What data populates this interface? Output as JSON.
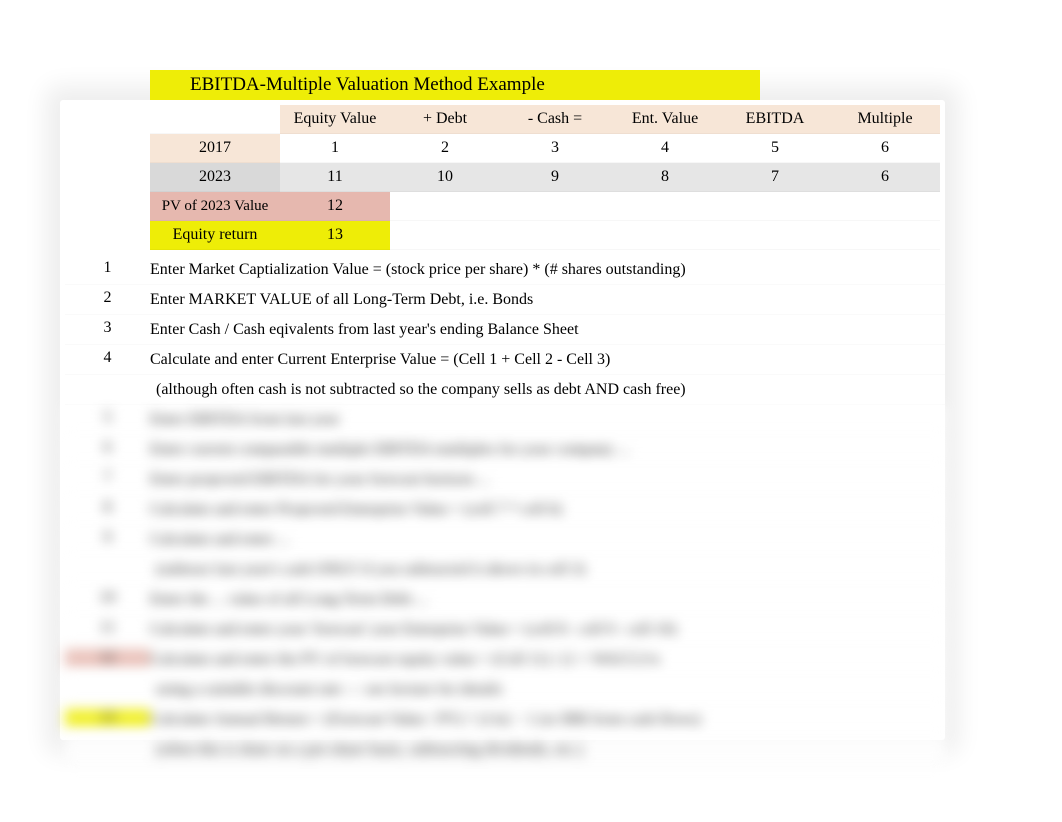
{
  "title": "EBITDA-Multiple Valuation Method Example",
  "headers": {
    "c1": "Equity Value",
    "c2": "+ Debt",
    "c3": "- Cash =",
    "c4": "Ent. Value",
    "c5": "EBITDA",
    "c6": "Multiple"
  },
  "rows": {
    "y2017": {
      "label": "2017",
      "c1": "1",
      "c2": "2",
      "c3": "3",
      "c4": "4",
      "c5": "5",
      "c6": "6"
    },
    "y2023": {
      "label": "2023",
      "c1": "11",
      "c2": "10",
      "c3": "9",
      "c4": "8",
      "c5": "7",
      "c6": "6"
    },
    "pv": {
      "label": "PV of 2023 Value",
      "c1": "12"
    },
    "eqret": {
      "label": "Equity return",
      "c1": "13"
    }
  },
  "instructions": [
    {
      "n": "1",
      "text": "Enter Market Captialization Value = (stock price per share) * (# shares outstanding)"
    },
    {
      "n": "2",
      "text": "Enter MARKET VALUE of all Long-Term Debt, i.e. Bonds"
    },
    {
      "n": "3",
      "text": "Enter Cash / Cash eqivalents from last year's ending Balance Sheet"
    },
    {
      "n": "4",
      "text": "Calculate and enter Current Enterprise Value = (Cell 1 + Cell 2 - Cell 3)"
    },
    {
      "n": "",
      "text": " (although often cash is not subtracted so the company sells as debt AND cash free)",
      "sub": true
    },
    {
      "n": "5",
      "text": "Enter EBITDA from last year",
      "blur": true
    },
    {
      "n": "6",
      "text": "Enter current comparable multiple EBITDA multiples for your company ... ",
      "blur": true
    },
    {
      "n": "7",
      "text": "Enter projected EBITDA for your forecast horizon ... ",
      "blur": true
    },
    {
      "n": "8",
      "text": "Calculate and enter Projected Enterprise Value = (cell 7 * cell 6) ",
      "blur": true
    },
    {
      "n": "9",
      "text": "Calculate and enter ... ",
      "blur": true
    },
    {
      "n": "",
      "text": "   (subtract last year's cash ONLY if you subtracted it above in cell 3) ",
      "blur": true,
      "sub": true
    },
    {
      "n": "10",
      "text": "Enter the ... value of all Long-Term Debt ... ",
      "blur": true
    },
    {
      "n": "11",
      "text": "Calculate and enter your 'forecast' year Enterprise Value = (cell 8 - cell 9 - cell 10) ",
      "blur": true
    },
    {
      "n": "12",
      "text": "Calculate and enter the PV of forecast equity value = (Cell 11) / (1 + WACC)^n",
      "blur": true,
      "cls": "pv"
    },
    {
      "n": "",
      "text": "using a suitable discount rate — see lecture for details",
      "blur": true,
      "sub": true,
      "cls": "pv"
    },
    {
      "n": "13",
      "text": "Calculate Annual Return = (Forecast Value / PV) ^ (1/n) − 1    (or IRR from cash flows)",
      "blur": true,
      "cls": "yeq"
    },
    {
      "n": "",
      "text": "(often this is done on a per-share basis, subtracting dividends, etc.)",
      "blur": true,
      "sub": true,
      "cls": "yeq"
    }
  ]
}
